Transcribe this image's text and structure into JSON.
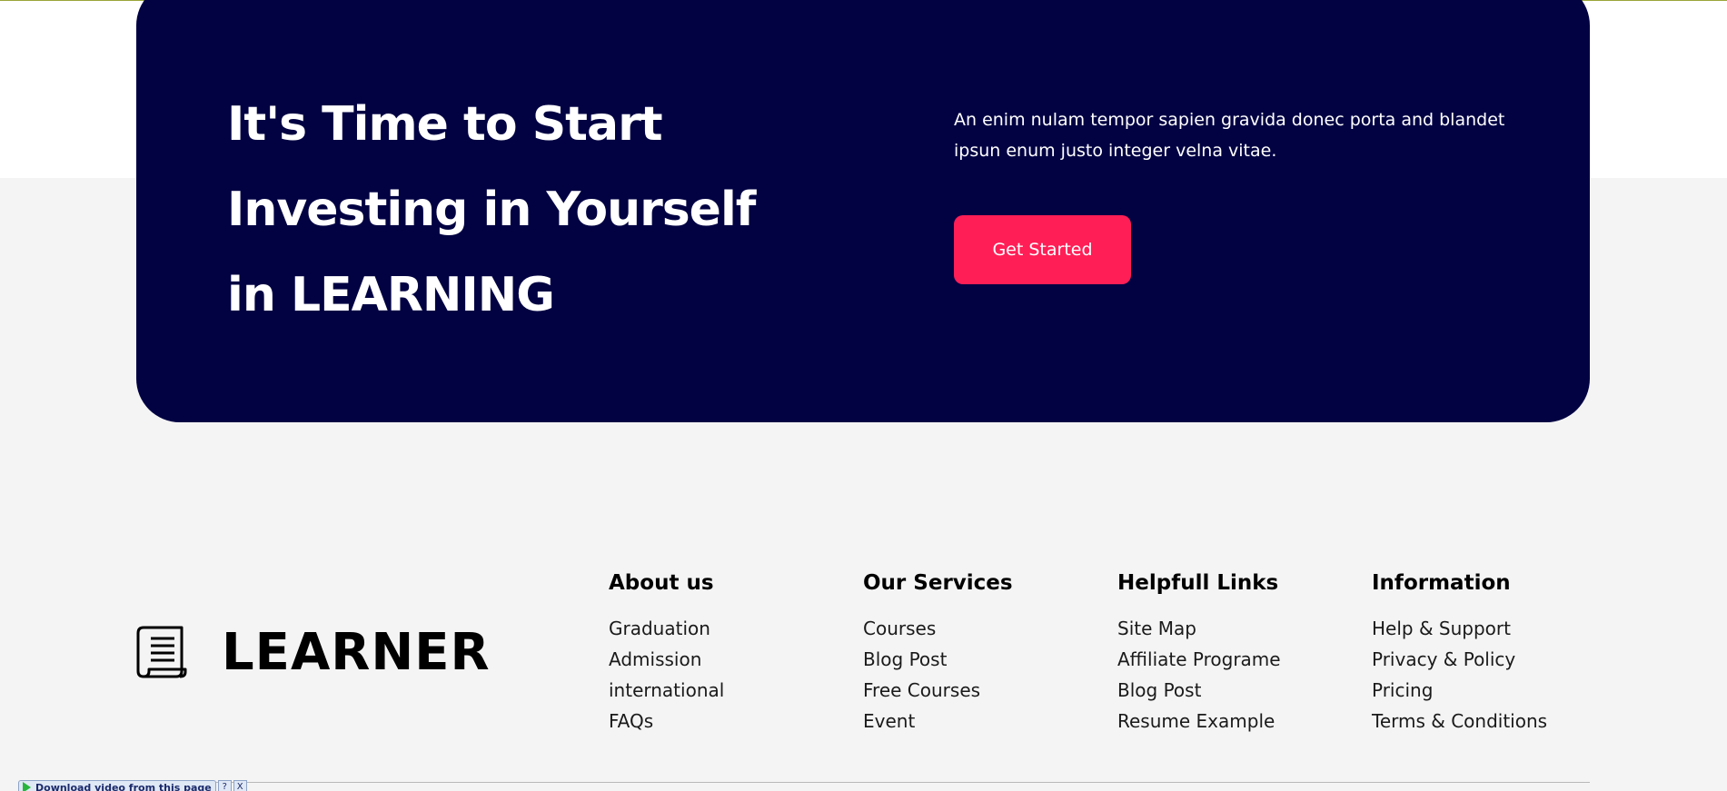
{
  "cta": {
    "heading_lines": [
      "It's Time to Start",
      "Investing in Yourself",
      "in LEARNING"
    ],
    "description": "An enim nulam tempor sapien gravida donec porta and blandet ipsun enum justo integer velna vitae.",
    "button_label": "Get Started"
  },
  "brand": {
    "name": "LEARNER",
    "icon": "scroll-document-icon"
  },
  "footer": {
    "columns": [
      {
        "title": "About us",
        "links": [
          "Graduation",
          "Admission",
          "international",
          "FAQs"
        ]
      },
      {
        "title": "Our Services",
        "links": [
          "Courses",
          "Blog Post",
          "Free Courses",
          "Event"
        ]
      },
      {
        "title": "Helpfull Links",
        "links": [
          "Site Map",
          "Affiliate Programe",
          "Blog Post",
          "Resume Example"
        ]
      },
      {
        "title": "Information",
        "links": [
          "Help & Support",
          "Privacy & Policy",
          "Pricing",
          "Terms & Conditions"
        ]
      }
    ]
  },
  "download_bar": {
    "label": "Download video from this page",
    "help": "?",
    "close": "X"
  },
  "colors": {
    "cta_background": "#020243",
    "button": "#ff1e56",
    "page_background": "#f4f4f4"
  }
}
